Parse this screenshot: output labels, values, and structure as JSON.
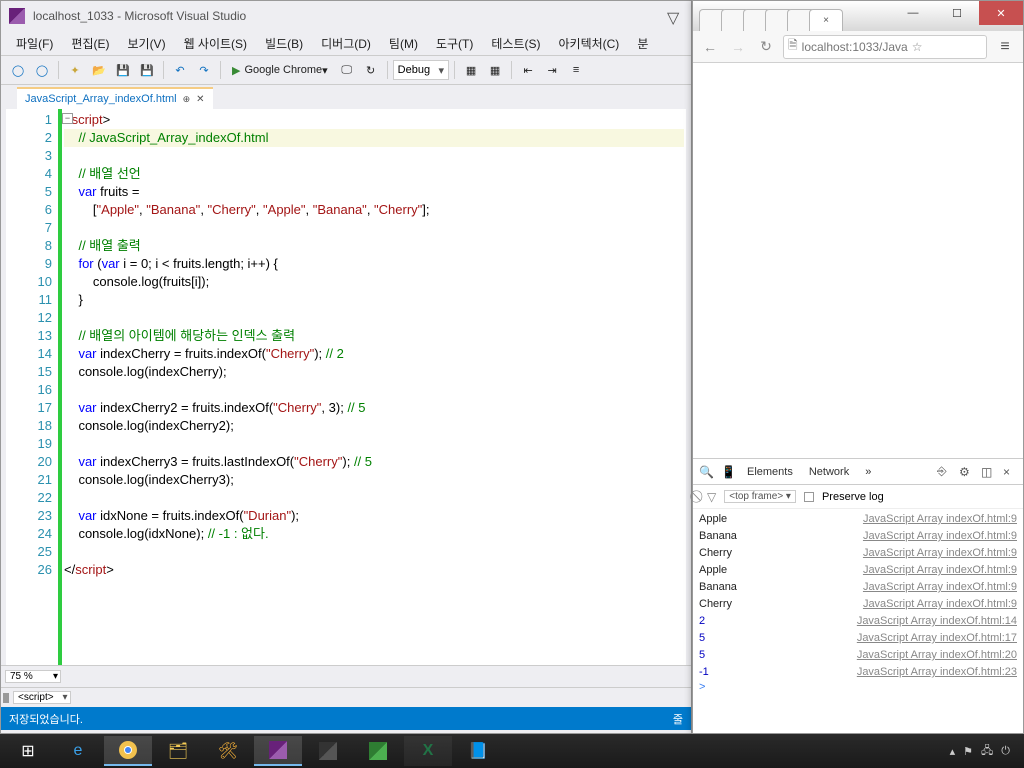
{
  "vs": {
    "title": "localhost_1033 - Microsoft Visual Studio",
    "menu": [
      "파일(F)",
      "편집(E)",
      "보기(V)",
      "웹 사이트(S)",
      "빌드(B)",
      "디버그(D)",
      "팀(M)",
      "도구(T)",
      "테스트(S)",
      "아키텍처(C)",
      "분"
    ],
    "run_target": "Google Chrome",
    "config": "Debug",
    "tab": "JavaScript_Array_indexOf.html",
    "zoom": "75 %",
    "breadcrumb": "<script>",
    "status": "저장되었습니다.",
    "code_lines": [
      {
        "n": 1,
        "parts": [
          {
            "t": "<",
            "c": ""
          },
          {
            "t": "script",
            "c": "t-tag"
          },
          {
            "t": ">",
            "c": ""
          }
        ]
      },
      {
        "n": 2,
        "bg": true,
        "indent": "    ",
        "parts": [
          {
            "t": "// JavaScript_Array_indexOf.html",
            "c": "t-cmt"
          }
        ]
      },
      {
        "n": 3,
        "parts": []
      },
      {
        "n": 4,
        "indent": "    ",
        "parts": [
          {
            "t": "// 배열 선언",
            "c": "t-cmt"
          }
        ]
      },
      {
        "n": 5,
        "indent": "    ",
        "parts": [
          {
            "t": "var",
            "c": "t-kw"
          },
          {
            "t": " fruits =",
            "c": ""
          }
        ]
      },
      {
        "n": 6,
        "indent": "        ",
        "parts": [
          {
            "t": "[",
            "c": ""
          },
          {
            "t": "\"Apple\"",
            "c": "t-str"
          },
          {
            "t": ", ",
            "c": ""
          },
          {
            "t": "\"Banana\"",
            "c": "t-str"
          },
          {
            "t": ", ",
            "c": ""
          },
          {
            "t": "\"Cherry\"",
            "c": "t-str"
          },
          {
            "t": ", ",
            "c": ""
          },
          {
            "t": "\"Apple\"",
            "c": "t-str"
          },
          {
            "t": ", ",
            "c": ""
          },
          {
            "t": "\"Banana\"",
            "c": "t-str"
          },
          {
            "t": ", ",
            "c": ""
          },
          {
            "t": "\"Cherry\"",
            "c": "t-str"
          },
          {
            "t": "];",
            "c": ""
          }
        ]
      },
      {
        "n": 7,
        "parts": []
      },
      {
        "n": 8,
        "indent": "    ",
        "parts": [
          {
            "t": "// 배열 출력",
            "c": "t-cmt"
          }
        ]
      },
      {
        "n": 9,
        "indent": "    ",
        "parts": [
          {
            "t": "for",
            "c": "t-kw"
          },
          {
            "t": " (",
            "c": ""
          },
          {
            "t": "var",
            "c": "t-kw"
          },
          {
            "t": " i = 0; i < fruits.length; i++) {",
            "c": ""
          }
        ]
      },
      {
        "n": 10,
        "indent": "        ",
        "parts": [
          {
            "t": "console.log(fruits[i]);",
            "c": ""
          }
        ]
      },
      {
        "n": 11,
        "indent": "    ",
        "parts": [
          {
            "t": "}",
            "c": ""
          }
        ]
      },
      {
        "n": 12,
        "parts": []
      },
      {
        "n": 13,
        "indent": "    ",
        "parts": [
          {
            "t": "// 배열의 아이템에 해당하는 인덱스 출력",
            "c": "t-cmt"
          }
        ]
      },
      {
        "n": 14,
        "indent": "    ",
        "parts": [
          {
            "t": "var",
            "c": "t-kw"
          },
          {
            "t": " indexCherry = fruits.indexOf(",
            "c": ""
          },
          {
            "t": "\"Cherry\"",
            "c": "t-str"
          },
          {
            "t": "); ",
            "c": ""
          },
          {
            "t": "// 2",
            "c": "t-cmt"
          }
        ]
      },
      {
        "n": 15,
        "indent": "    ",
        "parts": [
          {
            "t": "console.log(indexCherry);",
            "c": ""
          }
        ]
      },
      {
        "n": 16,
        "parts": []
      },
      {
        "n": 17,
        "indent": "    ",
        "parts": [
          {
            "t": "var",
            "c": "t-kw"
          },
          {
            "t": " indexCherry2 = fruits.indexOf(",
            "c": ""
          },
          {
            "t": "\"Cherry\"",
            "c": "t-str"
          },
          {
            "t": ", 3); ",
            "c": ""
          },
          {
            "t": "// 5",
            "c": "t-cmt"
          }
        ]
      },
      {
        "n": 18,
        "indent": "    ",
        "parts": [
          {
            "t": "console.log(indexCherry2);",
            "c": ""
          }
        ]
      },
      {
        "n": 19,
        "parts": []
      },
      {
        "n": 20,
        "indent": "    ",
        "parts": [
          {
            "t": "var",
            "c": "t-kw"
          },
          {
            "t": " indexCherry3 = fruits.lastIndexOf(",
            "c": ""
          },
          {
            "t": "\"Cherry\"",
            "c": "t-str"
          },
          {
            "t": "); ",
            "c": ""
          },
          {
            "t": "// 5",
            "c": "t-cmt"
          }
        ]
      },
      {
        "n": 21,
        "indent": "    ",
        "parts": [
          {
            "t": "console.log(indexCherry3);",
            "c": ""
          }
        ]
      },
      {
        "n": 22,
        "parts": []
      },
      {
        "n": 23,
        "indent": "    ",
        "parts": [
          {
            "t": "var",
            "c": "t-kw"
          },
          {
            "t": " idxNone = fruits.indexOf(",
            "c": ""
          },
          {
            "t": "\"Durian\"",
            "c": "t-str"
          },
          {
            "t": ");",
            "c": ""
          }
        ]
      },
      {
        "n": 24,
        "indent": "    ",
        "parts": [
          {
            "t": "console.log(idxNone); ",
            "c": ""
          },
          {
            "t": "// -1 : 없다.",
            "c": "t-cmt"
          }
        ]
      },
      {
        "n": 25,
        "parts": []
      },
      {
        "n": 26,
        "parts": [
          {
            "t": "</",
            "c": ""
          },
          {
            "t": "script",
            "c": "t-tag"
          },
          {
            "t": ">",
            "c": ""
          }
        ]
      }
    ]
  },
  "chrome": {
    "url": "localhost:1033/Java",
    "devtools": {
      "tabs": [
        "Elements",
        "Network"
      ],
      "more": "»",
      "topframe": "<top frame>",
      "preserve": "Preserve log",
      "log": [
        {
          "v": "Apple",
          "num": false,
          "src": "JavaScript Array indexOf.html:9"
        },
        {
          "v": "Banana",
          "num": false,
          "src": "JavaScript Array indexOf.html:9"
        },
        {
          "v": "Cherry",
          "num": false,
          "src": "JavaScript Array indexOf.html:9"
        },
        {
          "v": "Apple",
          "num": false,
          "src": "JavaScript Array indexOf.html:9"
        },
        {
          "v": "Banana",
          "num": false,
          "src": "JavaScript Array indexOf.html:9"
        },
        {
          "v": "Cherry",
          "num": false,
          "src": "JavaScript Array indexOf.html:9"
        },
        {
          "v": "2",
          "num": true,
          "src": "JavaScript Array indexOf.html:14"
        },
        {
          "v": "5",
          "num": true,
          "src": "JavaScript Array indexOf.html:17"
        },
        {
          "v": "5",
          "num": true,
          "src": "JavaScript Array indexOf.html:20"
        },
        {
          "v": "-1",
          "num": true,
          "src": "JavaScript Array indexOf.html:23"
        }
      ]
    }
  }
}
